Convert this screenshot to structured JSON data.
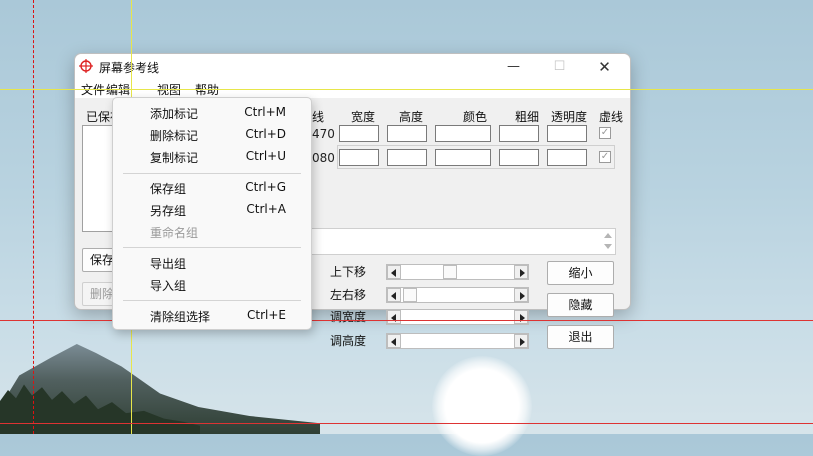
{
  "window": {
    "title": "屏幕参考线",
    "min_glyph": "—",
    "max_glyph": "☐",
    "close_glyph": "✕"
  },
  "menubar": {
    "file": "文件",
    "edit": "编辑",
    "view": "视图",
    "help": "帮助"
  },
  "left_panel": {
    "saved_label": "已保存",
    "save_button": "保存",
    "delete_button": "删除"
  },
  "table": {
    "headers": {
      "line": "线",
      "width": "宽度",
      "height": "高度",
      "color": "颜色",
      "thickness": "粗细",
      "opacity": "透明度",
      "dashed": "虚线"
    },
    "rows": [
      {
        "num": "470",
        "dashed_check": "✓"
      },
      {
        "num": "080",
        "dashed_check": "✓"
      }
    ]
  },
  "sliders": {
    "up_down": "上下移",
    "left_right": "左右移",
    "adjust_width": "调宽度",
    "adjust_height": "调高度"
  },
  "buttons": {
    "shrink": "缩小",
    "hide": "隐藏",
    "exit": "退出"
  },
  "edit_menu": {
    "items": [
      {
        "label": "添加标记",
        "shortcut": "Ctrl+M"
      },
      {
        "label": "删除标记",
        "shortcut": "Ctrl+D"
      },
      {
        "label": "复制标记",
        "shortcut": "Ctrl+U"
      },
      {
        "label": "保存组",
        "shortcut": "Ctrl+G"
      },
      {
        "label": "另存组",
        "shortcut": "Ctrl+A"
      },
      {
        "label": "重命名组",
        "shortcut": ""
      },
      {
        "label": "导出组",
        "shortcut": ""
      },
      {
        "label": "导入组",
        "shortcut": ""
      },
      {
        "label": "清除组选择",
        "shortcut": "Ctrl+E"
      }
    ]
  },
  "colors": {
    "guide_red": "#dd3333",
    "guide_yellow": "#e7e64a"
  },
  "icons": {
    "app": "crosshair-icon",
    "spin_up": "triangle-up-icon",
    "spin_down": "triangle-down-icon"
  }
}
